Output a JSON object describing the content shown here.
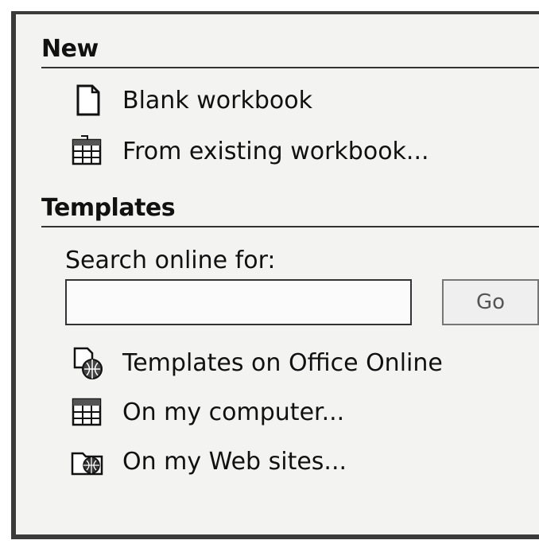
{
  "new_section": {
    "title": "New",
    "items": [
      {
        "label": "Blank workbook",
        "icon": "blank-document-icon"
      },
      {
        "label": "From existing workbook...",
        "icon": "workbook-icon"
      }
    ]
  },
  "templates_section": {
    "title": "Templates",
    "search": {
      "label": "Search online for:",
      "value": "",
      "go_label": "Go"
    },
    "items": [
      {
        "label": "Templates on Office Online",
        "icon": "web-templates-icon"
      },
      {
        "label": "On my computer...",
        "icon": "computer-templates-icon"
      },
      {
        "label": "On my Web sites...",
        "icon": "web-folder-icon"
      }
    ]
  }
}
